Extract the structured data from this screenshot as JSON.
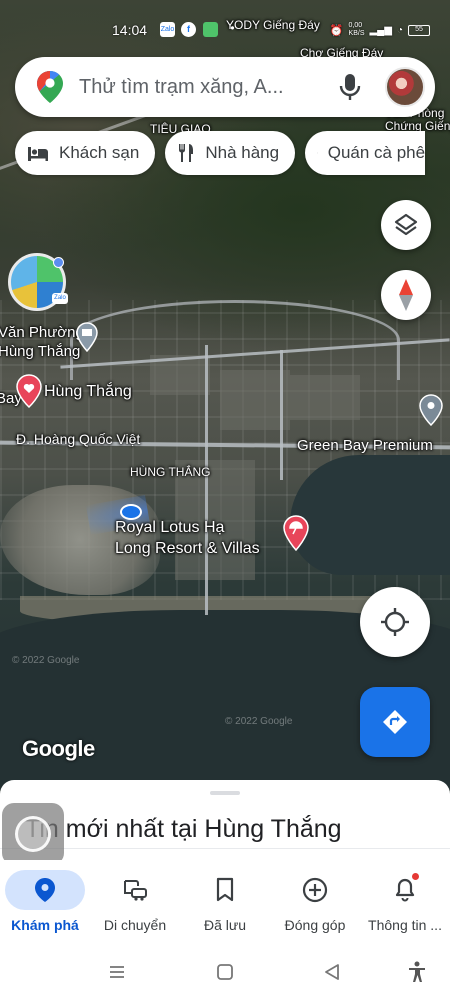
{
  "status_bar": {
    "time": "14:04",
    "speed": "0,00\nKB/S",
    "battery": "55"
  },
  "search": {
    "placeholder": "Thử tìm trạm xăng, A..."
  },
  "chips": [
    {
      "label": "Khách sạn",
      "icon": "bed-icon"
    },
    {
      "label": "Nhà hàng",
      "icon": "restaurant-icon"
    },
    {
      "label": "Quán cà phê",
      "icon": "coffee-icon"
    }
  ],
  "map": {
    "labels": {
      "yody": "YODY Giếng Đáy",
      "cho": "Chợ Giếng Đáy",
      "tieu_giao": "TIÊU GIAO",
      "van_phong_right": "Văn Phòng\nChứng Giếng",
      "van_phuong": "Văn Phường\nHùng Thắng",
      "bay_hung_thang": "Hùng Thắng",
      "bay_prefix": "Bay",
      "hoang_quoc_viet": "Đ. Hoàng Quốc Việt",
      "green_bay": "Green Bay Premium",
      "hung_thang_area": "HÙNG THẮNG",
      "royal_lotus": "Royal Lotus Hạ\nLong Resort & Villas",
      "copyright_1": "© 2022 Google",
      "copyright_2": "© 2022 Google"
    },
    "watermark": "Google"
  },
  "sheet": {
    "title": "Tin mới nhất tại Hùng Thắng"
  },
  "nav": [
    {
      "label": "Khám phá",
      "icon": "explore-pin-icon",
      "active": true
    },
    {
      "label": "Di chuyển",
      "icon": "commute-icon",
      "active": false
    },
    {
      "label": "Đã lưu",
      "icon": "bookmark-icon",
      "active": false
    },
    {
      "label": "Đóng góp",
      "icon": "add-circle-icon",
      "active": false
    },
    {
      "label": "Thông tin ...",
      "icon": "bell-icon",
      "active": false
    }
  ],
  "colors": {
    "accent": "#1a73e8",
    "active_pill": "#d3e3fd",
    "active_label": "#0b57d0",
    "pin_red": "#e8455a",
    "notification": "#e53935"
  }
}
